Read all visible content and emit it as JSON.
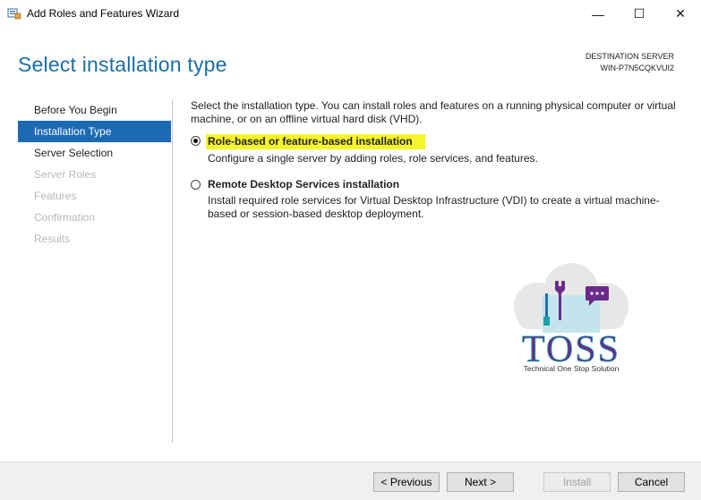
{
  "window": {
    "title": "Add Roles and Features Wizard",
    "min_glyph": "—",
    "max_glyph": "☐",
    "close_glyph": "✕"
  },
  "header": {
    "title": "Select installation type",
    "dest_label": "DESTINATION SERVER",
    "dest_server": "WIN-P7N5CQKVUI2"
  },
  "nav": {
    "items": [
      {
        "label": "Before You Begin",
        "state": "normal"
      },
      {
        "label": "Installation Type",
        "state": "active"
      },
      {
        "label": "Server Selection",
        "state": "normal"
      },
      {
        "label": "Server Roles",
        "state": "disabled"
      },
      {
        "label": "Features",
        "state": "disabled"
      },
      {
        "label": "Confirmation",
        "state": "disabled"
      },
      {
        "label": "Results",
        "state": "disabled"
      }
    ]
  },
  "content": {
    "intro": "Select the installation type. You can install roles and features on a running physical computer or virtual machine, or on an offline virtual hard disk (VHD).",
    "options": [
      {
        "label": "Role-based or feature-based installation",
        "desc": "Configure a single server by adding roles, role services, and features.",
        "selected": true
      },
      {
        "label": "Remote Desktop Services installation",
        "desc": "Install required role services for Virtual Desktop Infrastructure (VDI) to create a virtual machine-based or session-based desktop deployment.",
        "selected": false
      }
    ]
  },
  "watermark": {
    "brand": "TOSS",
    "tagline": "Technical One Stop Solution"
  },
  "footer": {
    "previous": "< Previous",
    "next": "Next >",
    "install": "Install",
    "cancel": "Cancel"
  },
  "colors": {
    "accent": "#1c6ab4",
    "title_blue": "#1a6fa8",
    "highlight": "#f5f52a",
    "brand_purple": "#6a2c8c",
    "brand_teal": "#1aa0a8"
  }
}
